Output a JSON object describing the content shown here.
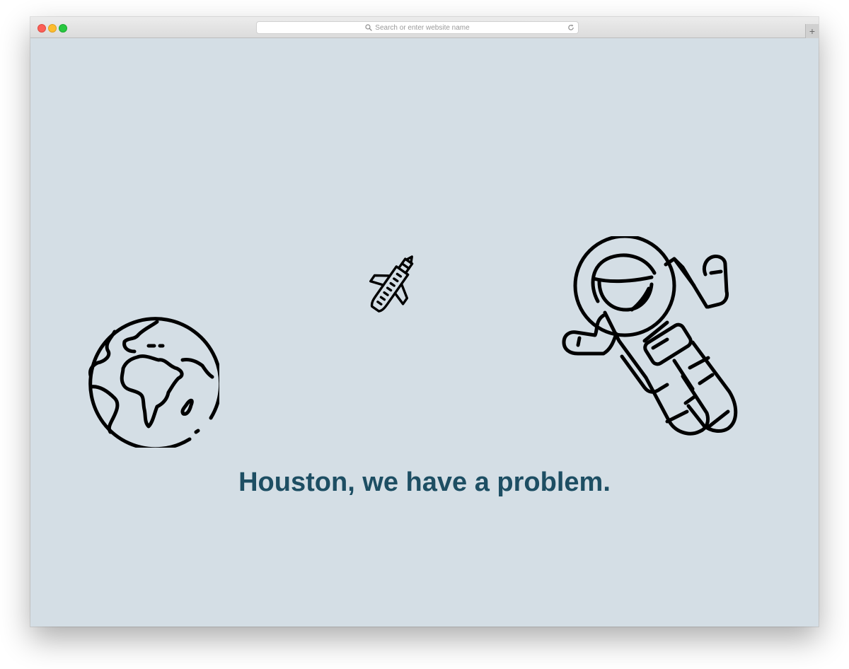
{
  "browser": {
    "address_placeholder": "Search or enter website name",
    "new_tab_label": "+"
  },
  "page": {
    "background_color": "#d4dee5",
    "headline": "Houston, we have a problem.",
    "headline_color": "#1d4e63",
    "illustrations": [
      "earth-icon",
      "space-shuttle-icon",
      "astronaut-icon"
    ]
  }
}
